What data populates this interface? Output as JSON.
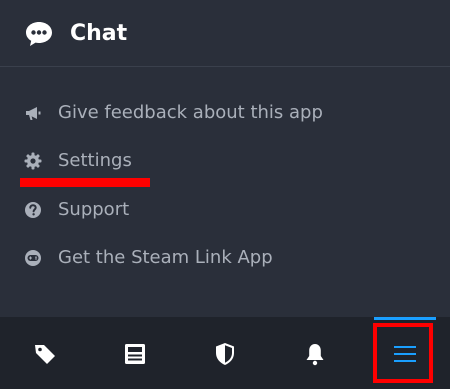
{
  "header": {
    "title": "Chat",
    "icon": "chat-bubble-icon"
  },
  "menu": {
    "items": [
      {
        "label": "Give feedback about this app",
        "icon": "megaphone-icon"
      },
      {
        "label": "Settings",
        "icon": "gear-icon"
      },
      {
        "label": "Support",
        "icon": "question-circle-icon"
      },
      {
        "label": "Get the Steam Link App",
        "icon": "gamepad-circle-icon"
      }
    ]
  },
  "bottom_nav": {
    "tabs": [
      {
        "icon": "tag-icon",
        "active": false
      },
      {
        "icon": "news-icon",
        "active": false
      },
      {
        "icon": "shield-icon",
        "active": false
      },
      {
        "icon": "bell-icon",
        "active": false
      },
      {
        "icon": "hamburger-menu-icon",
        "active": true
      }
    ]
  },
  "colors": {
    "background": "#2a2f3a",
    "bottom_bar": "#1f232b",
    "menu_text": "#aab0ba",
    "accent": "#1a9fff",
    "annotation": "#ff0000"
  }
}
